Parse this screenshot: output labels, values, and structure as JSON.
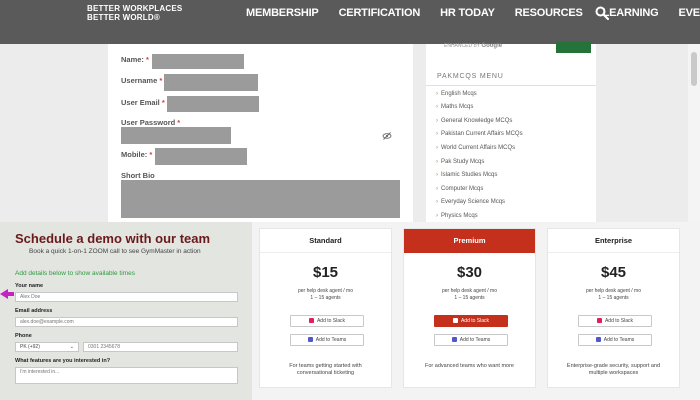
{
  "nav": {
    "logo_line1": "BETTER WORKPLACES",
    "logo_line2": "BETTER WORLD®",
    "items": [
      "MEMBERSHIP",
      "CERTIFICATION",
      "HR TODAY",
      "RESOURCES",
      "LEARNING",
      "EVENTS"
    ]
  },
  "form": {
    "name_label": "Name:",
    "username_label": "Username",
    "email_label": "User Email",
    "password_label": "User Password",
    "mobile_label": "Mobile:",
    "bio_label": "Short Bio",
    "required_mark": "*"
  },
  "sidebar": {
    "enhanced_prefix": "ENHANCED BY",
    "enhanced_brand": "Google",
    "menu_title": "PAKMCQS MENU",
    "items": [
      "English Mcqs",
      "Maths Mcqs",
      "General Knowledge MCQs",
      "Pakistan Current Affairs MCQs",
      "World Current Affairs MCQs",
      "Pak Study Mcqs",
      "Islamic Studies Mcqs",
      "Computer Mcqs",
      "Everyday Science Mcqs",
      "Physics Mcqs"
    ]
  },
  "demo": {
    "title": "Schedule a demo with our team",
    "subtitle": "Book a quick 1-on-1 ZOOM call to see GymMaster in action",
    "instruction": "Add details below to show available times",
    "name_label": "Your name",
    "name_placeholder": "Alex Doe",
    "email_label": "Email address",
    "email_placeholder": "alex.doe@example.com",
    "phone_label": "Phone",
    "phone_country": "PK (+92)",
    "phone_placeholder": "0301 2345678",
    "features_label": "What features are you interested in?",
    "features_placeholder": "I'm interested in..."
  },
  "pricing": {
    "plans": [
      {
        "name": "Standard",
        "price": "$15",
        "per": "per help desk agent / mo",
        "agents": "1 – 15 agents",
        "slack": "Add to Slack",
        "teams": "Add to Teams",
        "desc1": "For teams getting started with",
        "desc2": "conversational ticketing"
      },
      {
        "name": "Premium",
        "price": "$30",
        "per": "per help desk agent / mo",
        "agents": "1 – 15 agents",
        "slack": "Add to Slack",
        "teams": "Add to Teams",
        "desc1": "For advanced teams who want more",
        "desc2": ""
      },
      {
        "name": "Enterprise",
        "price": "$45",
        "per": "per help desk agent / mo",
        "agents": "1 – 15 agents",
        "slack": "Add to Slack",
        "teams": "Add to Teams",
        "desc1": "Enterprise-grade security, support and",
        "desc2": "multiple workspaces"
      }
    ]
  },
  "colors": {
    "nav_bg": "#5a5a5a",
    "demo_title": "#6a1a1a",
    "instruction_green": "#2f9a3f",
    "premium_red": "#c4301c",
    "arrow_magenta": "#c423c4"
  }
}
